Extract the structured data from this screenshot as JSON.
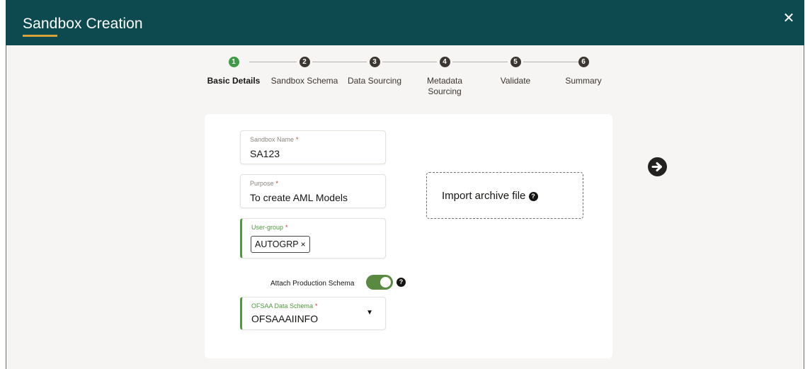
{
  "header": {
    "title": "Sandbox Creation",
    "close_icon": "close-icon"
  },
  "stepper": {
    "steps": [
      {
        "num": "1",
        "label": "Basic Details",
        "active": true
      },
      {
        "num": "2",
        "label": "Sandbox Schema"
      },
      {
        "num": "3",
        "label": "Data Sourcing"
      },
      {
        "num": "4",
        "label": "Metadata Sourcing"
      },
      {
        "num": "5",
        "label": "Validate"
      },
      {
        "num": "6",
        "label": "Summary"
      }
    ],
    "active_color": "#3f9c46"
  },
  "form": {
    "sandbox_name": {
      "label": "Sandbox Name",
      "required": "*",
      "value": "SA123"
    },
    "purpose": {
      "label": "Purpose",
      "required": "*",
      "value": "To create AML Models"
    },
    "user_group": {
      "label": "User-group",
      "required": "*",
      "chip": "AUTOGRP",
      "chip_remove": "×"
    },
    "attach_production_schema": {
      "label": "Attach Production Schema",
      "enabled": true,
      "help": "?"
    },
    "ofsaa_data_schema": {
      "label": "OFSAA Data Schema",
      "required": "*",
      "value": "OFSAAAIINFO",
      "arrow": "▼"
    }
  },
  "import": {
    "label": "Import archive file",
    "help": "?"
  },
  "next_button": {
    "icon": "arrow-right-circle-icon"
  },
  "colors": {
    "header_bg": "#0d4a50",
    "accent_underline": "#d7a23a",
    "field_accent": "#4f9a3c"
  }
}
